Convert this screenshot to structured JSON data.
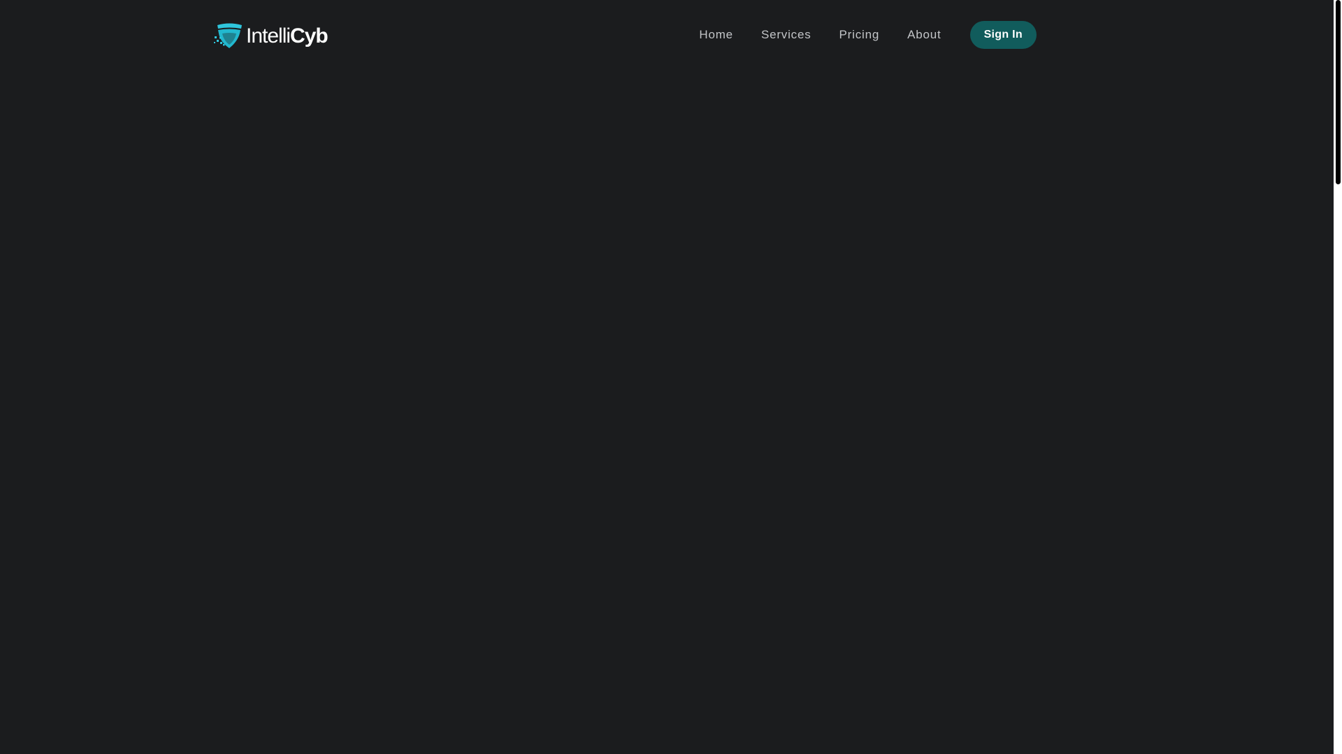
{
  "brand": {
    "name_light": "Intelli",
    "name_bold": "Cyb",
    "icon": "shield-icon",
    "accent_color": "#22b8cf"
  },
  "nav": {
    "items": [
      {
        "label": "Home"
      },
      {
        "label": "Services"
      },
      {
        "label": "Pricing"
      },
      {
        "label": "About"
      }
    ],
    "sign_in_label": "Sign In",
    "sign_in_color": "#115c5c"
  },
  "colors": {
    "background": "#1b1c1e",
    "nav_text": "#c3c5c8"
  }
}
